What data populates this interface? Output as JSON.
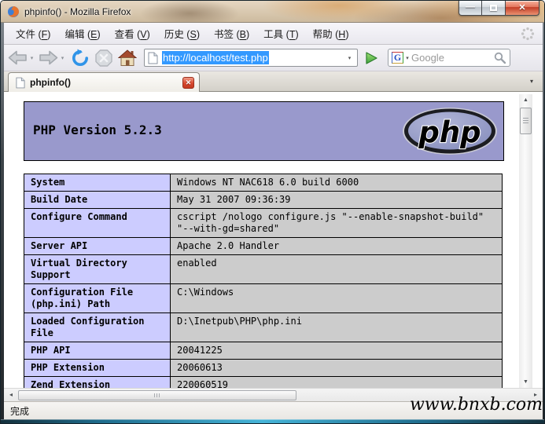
{
  "titlebar": {
    "title": "phpinfo() - Mozilla Firefox",
    "minimize_glyph": "—",
    "close_glyph": "✕"
  },
  "menubar": {
    "open": " (",
    "close": ")",
    "items": [
      {
        "label": "文件",
        "key": "F"
      },
      {
        "label": "编辑",
        "key": "E"
      },
      {
        "label": "查看",
        "key": "V"
      },
      {
        "label": "历史",
        "key": "S"
      },
      {
        "label": "书签",
        "key": "B"
      },
      {
        "label": "工具",
        "key": "T"
      },
      {
        "label": "帮助",
        "key": "H"
      }
    ]
  },
  "navbar": {
    "url": "http://localhost/test.php",
    "dropdown_glyph": "▾",
    "search_placeholder": "Google",
    "google_logo": "G"
  },
  "tabbar": {
    "tab_label": "phpinfo()",
    "close_glyph": "✕",
    "list_glyph": "▾"
  },
  "page": {
    "header_title": "PHP Version 5.2.3",
    "logo_text": "php",
    "rows": [
      {
        "name": "System",
        "value": "Windows NT NAC618 6.0 build 6000"
      },
      {
        "name": "Build Date",
        "value": "May 31 2007 09:36:39"
      },
      {
        "name": "Configure Command",
        "value": "cscript /nologo configure.js \"--enable-snapshot-build\" \"--with-gd=shared\""
      },
      {
        "name": "Server API",
        "value": "Apache 2.0 Handler"
      },
      {
        "name": "Virtual Directory Support",
        "value": "enabled"
      },
      {
        "name": "Configuration File (php.ini) Path",
        "value": "C:\\Windows"
      },
      {
        "name": "Loaded Configuration File",
        "value": "D:\\Inetpub\\PHP\\php.ini"
      },
      {
        "name": "PHP API",
        "value": "20041225"
      },
      {
        "name": "PHP Extension",
        "value": "20060613"
      },
      {
        "name": "Zend Extension",
        "value": "220060519"
      }
    ]
  },
  "scrollbars": {
    "up": "▲",
    "down": "▼",
    "left": "◂",
    "right": "▸"
  },
  "statusbar": {
    "text": "完成"
  },
  "watermark": "www.bnxb.com",
  "colors": {
    "selection_blue": "#3399ff",
    "php_header_bg": "#9999cc",
    "row_label_bg": "#ccccff",
    "row_value_bg": "#cccccc",
    "tab_close_red": "#d8472e",
    "window_close_red": "#c23d26",
    "go_arrow_green": "#3da23d",
    "reload_blue": "#3094e8"
  },
  "icons": {
    "firefox_logo": "firefox-globe-and-fox",
    "back": "gray-left-arrow",
    "forward": "gray-right-arrow",
    "reload": "blue-circular-arrow",
    "stop": "gray-octagon-x",
    "home": "house",
    "page": "document-page",
    "go": "green-play-arrow",
    "search_magnifier": "magnifier",
    "throbber": "dotted-ring",
    "window_maximize": "▢"
  }
}
